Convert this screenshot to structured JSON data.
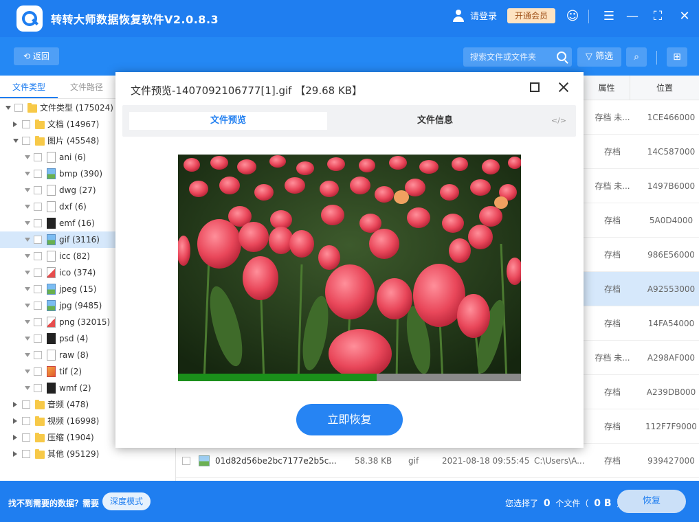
{
  "app": {
    "title": "转转大师数据恢复软件V2.0.8.3",
    "login": "请登录",
    "vip": "开通会员"
  },
  "toolbar": {
    "back": "返回",
    "search_placeholder": "搜索文件或文件夹",
    "filter": "筛选"
  },
  "left_tabs": [
    "文件类型",
    "文件路径"
  ],
  "tree": [
    {
      "label": "文件类型 (175024)",
      "level": 0,
      "expanded": true,
      "icon": "folder-icon"
    },
    {
      "label": "文档 (14967)",
      "level": 1,
      "expanded": false,
      "icon": "folder-icon"
    },
    {
      "label": "图片 (45548)",
      "level": 1,
      "expanded": true,
      "icon": "folder-icon"
    },
    {
      "label": "ani (6)",
      "level": 2,
      "icon": "file-icon"
    },
    {
      "label": "bmp (390)",
      "level": 2,
      "icon": "image-file-icon"
    },
    {
      "label": "dwg (27)",
      "level": 2,
      "icon": "file-icon"
    },
    {
      "label": "dxf (6)",
      "level": 2,
      "icon": "file-icon"
    },
    {
      "label": "emf (16)",
      "level": 2,
      "icon": "dark-file-icon"
    },
    {
      "label": "gif (3116)",
      "level": 2,
      "icon": "image-file-icon",
      "selected": true
    },
    {
      "label": "icc (82)",
      "level": 2,
      "icon": "file-icon"
    },
    {
      "label": "ico (374)",
      "level": 2,
      "icon": "red-file-icon"
    },
    {
      "label": "jpeg (15)",
      "level": 2,
      "icon": "image-file-icon"
    },
    {
      "label": "jpg (9485)",
      "level": 2,
      "icon": "image-file-icon"
    },
    {
      "label": "png (32015)",
      "level": 2,
      "icon": "red-file-icon"
    },
    {
      "label": "psd (4)",
      "level": 2,
      "icon": "dark-file-icon"
    },
    {
      "label": "raw (8)",
      "level": 2,
      "icon": "file-icon"
    },
    {
      "label": "tif (2)",
      "level": 2,
      "icon": "tif-file-icon"
    },
    {
      "label": "wmf (2)",
      "level": 2,
      "icon": "dark-file-icon"
    },
    {
      "label": "音频 (478)",
      "level": 1,
      "expanded": false,
      "icon": "folder-icon"
    },
    {
      "label": "视频 (16998)",
      "level": 1,
      "expanded": false,
      "icon": "folder-icon"
    },
    {
      "label": "压缩 (1904)",
      "level": 1,
      "expanded": false,
      "icon": "folder-icon"
    },
    {
      "label": "其他 (95129)",
      "level": 1,
      "expanded": false,
      "icon": "folder-icon"
    }
  ],
  "columns": {
    "attr": "属性",
    "location": "位置"
  },
  "rows": [
    {
      "name": "",
      "size": "",
      "type": "",
      "date": "",
      "path": "",
      "attr": "存档 未...",
      "location": "1CE466000"
    },
    {
      "name": "",
      "size": "",
      "type": "",
      "date": "",
      "path": "",
      "attr": "存档",
      "location": "14C587000"
    },
    {
      "name": "",
      "size": "",
      "type": "",
      "date": "",
      "path": "",
      "attr": "存档 未...",
      "location": "1497B6000"
    },
    {
      "name": "",
      "size": "",
      "type": "",
      "date": "",
      "path": "",
      "attr": "存档",
      "location": "5A0D4000"
    },
    {
      "name": "",
      "size": "",
      "type": "",
      "date": "",
      "path": "",
      "attr": "存档",
      "location": "986E56000"
    },
    {
      "name": "",
      "size": "",
      "type": "",
      "date": "",
      "path": "",
      "attr": "存档",
      "location": "A92553000",
      "selected": true
    },
    {
      "name": "",
      "size": "",
      "type": "",
      "date": "",
      "path": "",
      "attr": "存档",
      "location": "14FA54000"
    },
    {
      "name": "",
      "size": "",
      "type": "",
      "date": "",
      "path": "",
      "attr": "存档 未...",
      "location": "A298AF000"
    },
    {
      "name": "",
      "size": "",
      "type": "",
      "date": "",
      "path": "",
      "attr": "存档",
      "location": "A239DB000"
    },
    {
      "name": "",
      "size": "",
      "type": "",
      "date": "",
      "path": "",
      "attr": "存档",
      "location": "112F7F9000"
    },
    {
      "name": "01d82d56be2bc7177e2b5c...",
      "size": "58.38 KB",
      "type": "gif",
      "date": "2021-08-18 09:55:45",
      "path": "C:\\Users\\A...",
      "attr": "存档",
      "location": "939427000",
      "visible": true
    }
  ],
  "footer": {
    "help_text": "找不到需要的数据？需要",
    "deep_mode": "深度模式",
    "selected_prefix": "您选择了",
    "selected_count": "0",
    "selected_mid": "个文件（",
    "selected_size": "0 B",
    "selected_suffix": "）",
    "recover": "恢复"
  },
  "modal": {
    "title": "文件预览-1407092106777[1].gif 【29.68 KB】",
    "tab_preview": "文件预览",
    "tab_info": "文件信息",
    "code_icon": "</>",
    "recover_button": "立即恢复"
  },
  "colors": {
    "primary": "#1f7ef0",
    "selected": "#d6e8fb",
    "vip": "#fde3c2"
  }
}
